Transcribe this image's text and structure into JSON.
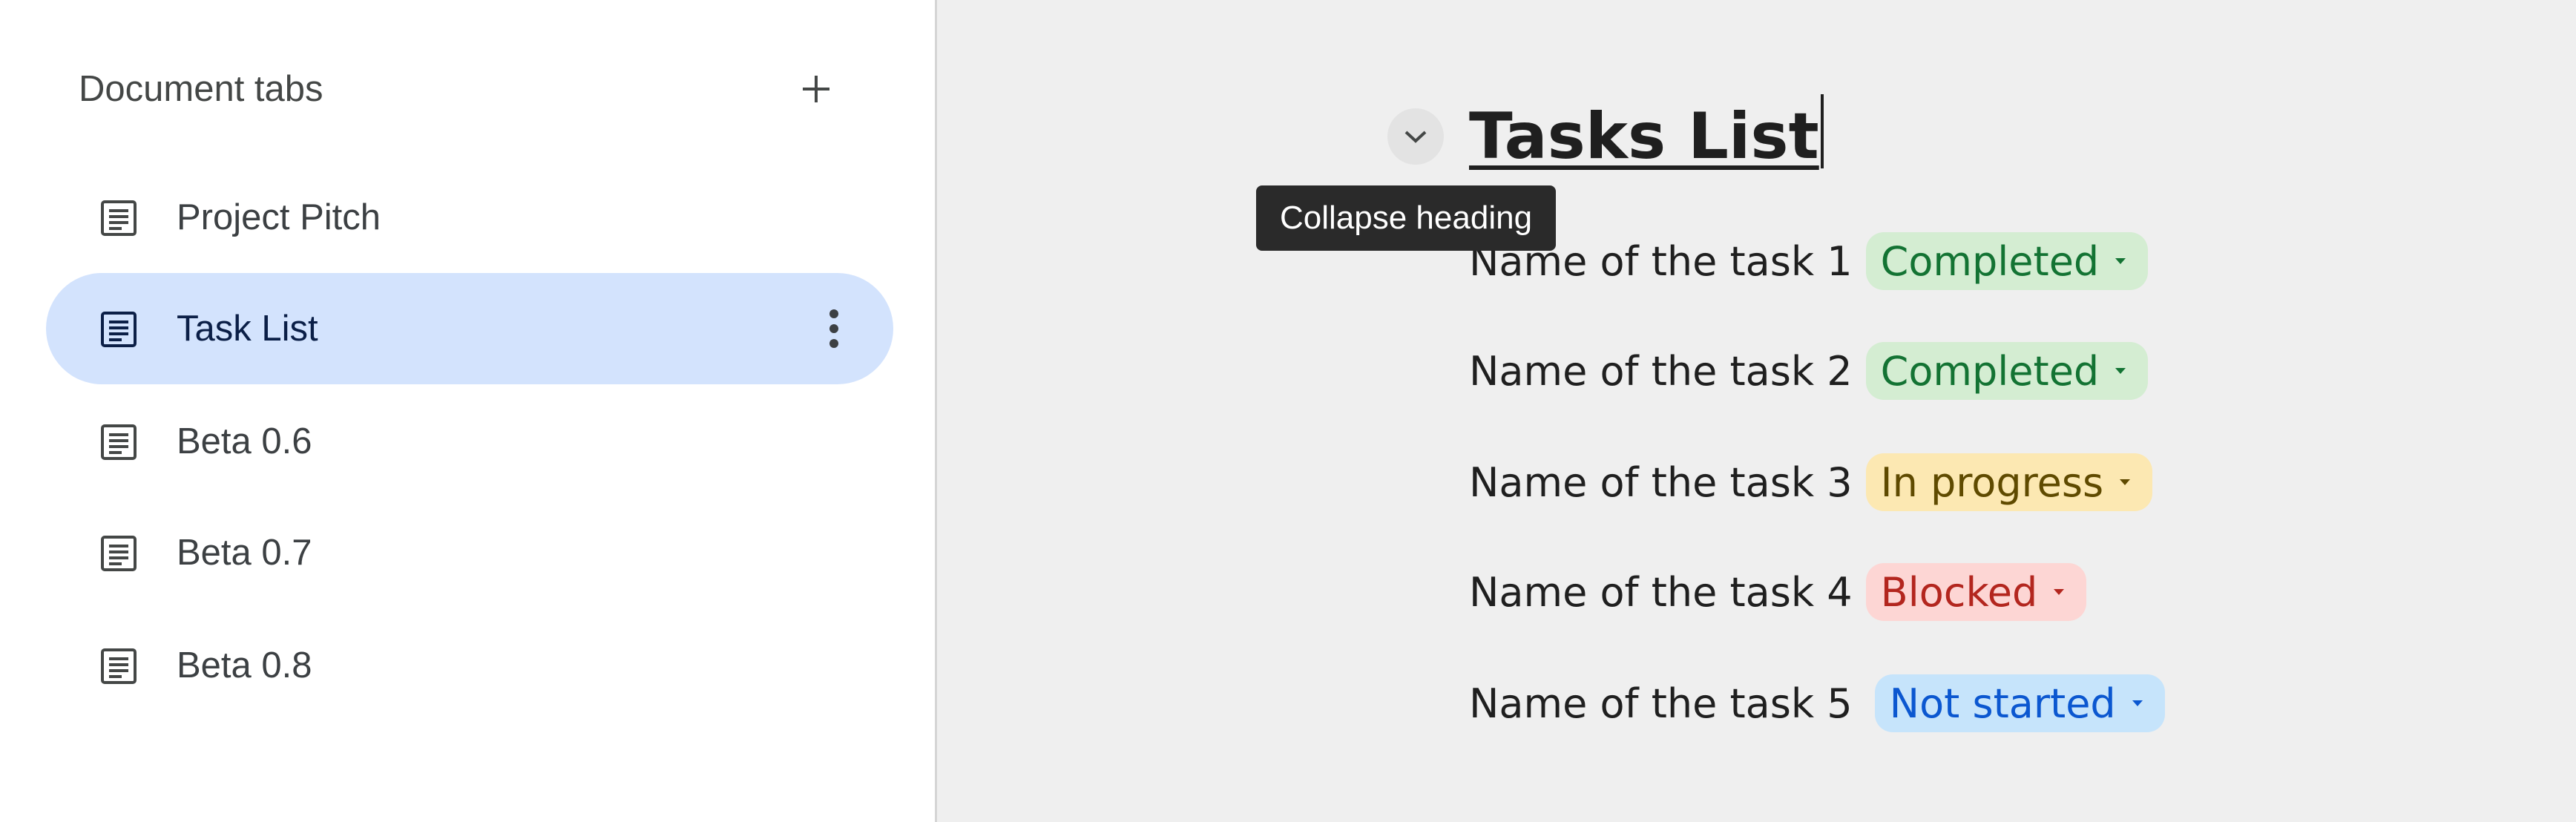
{
  "sidebar": {
    "title": "Document tabs",
    "add_icon": "plus-icon",
    "tabs": [
      {
        "label": "Project Pitch",
        "icon": "document-icon",
        "selected": false
      },
      {
        "label": "Task List",
        "icon": "document-icon",
        "selected": true
      },
      {
        "label": "Beta 0.6",
        "icon": "document-icon",
        "selected": false
      },
      {
        "label": "Beta 0.7",
        "icon": "document-icon",
        "selected": false
      },
      {
        "label": "Beta 0.8",
        "icon": "document-icon",
        "selected": false
      }
    ],
    "more_icon": "more-vertical-icon"
  },
  "document": {
    "heading": "Tasks List",
    "collapse_icon": "chevron-down-icon",
    "tooltip": "Collapse heading",
    "tasks": [
      {
        "name": "Name of the task 1",
        "status": "Completed"
      },
      {
        "name": "Name of the task 2",
        "status": "Completed"
      },
      {
        "name": "Name of the task 3",
        "status": "In progress"
      },
      {
        "name": "Name of the task 4",
        "status": "Blocked"
      },
      {
        "name": "Name of the task 5",
        "status": "Not started"
      }
    ]
  },
  "status_colors": {
    "Completed": {
      "bg": "#d4edd2",
      "fg": "#137333"
    },
    "In progress": {
      "bg": "#fce8b2",
      "fg": "#5f4a00"
    },
    "Blocked": {
      "bg": "#fdd6d4",
      "fg": "#b3261e"
    },
    "Not started": {
      "bg": "#c6e4fb",
      "fg": "#0b57d0"
    }
  }
}
